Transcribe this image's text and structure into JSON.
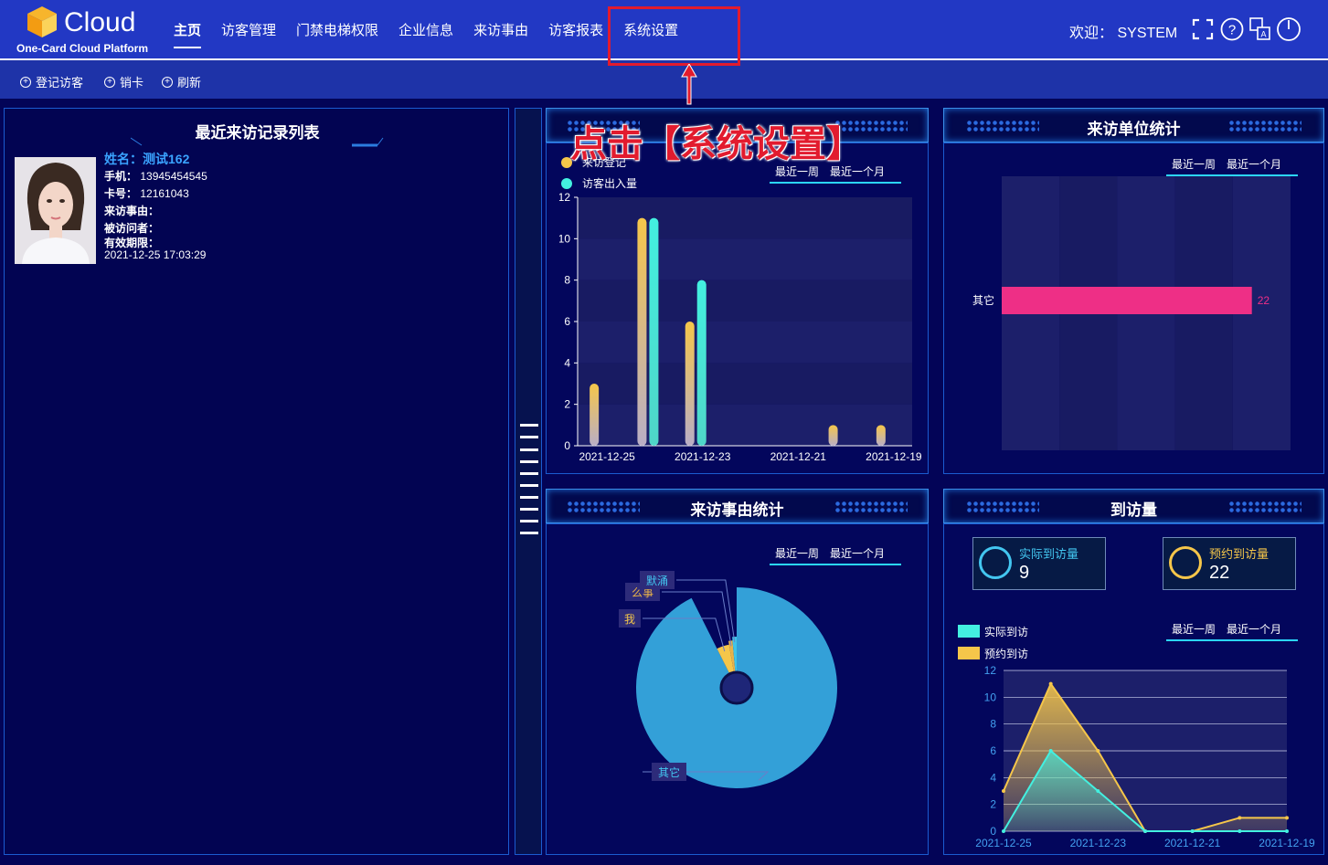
{
  "header": {
    "logo_text": "Cloud",
    "logo_sub": "One-Card Cloud Platform",
    "nav": [
      "主页",
      "访客管理",
      "门禁电梯权限",
      "企业信息",
      "来访事由",
      "访客报表",
      "系统设置"
    ],
    "welcome_label": "欢迎：",
    "user": "SYSTEM",
    "icons": [
      "fullscreen-icon",
      "help-icon",
      "translate-icon",
      "power-icon"
    ]
  },
  "toolbar": {
    "items": [
      "登记访客",
      "销卡",
      "刷新"
    ]
  },
  "annotation": {
    "text": "点击【系统设置】"
  },
  "recent_visits": {
    "title": "最近来访记录列表",
    "name": "姓名：测试162",
    "phone_label": "手机：",
    "phone": "13945454545",
    "card_label": "卡号：",
    "card": "12161043",
    "reason_label": "来访事由：",
    "visitee_label": "被访问者：",
    "expiry_label": "有效期限：",
    "expiry": "2021-12-25 17:03:29"
  },
  "panels": {
    "visitor_count": {
      "title": "",
      "tab_week": "最近一周",
      "tab_month": "最近一个月",
      "legend1": "来访登记",
      "legend2": "访客出入量"
    },
    "unit_stats": {
      "title": "来访单位统计",
      "tab_week": "最近一周",
      "tab_month": "最近一个月"
    },
    "reason_stats": {
      "title": "来访事由统计",
      "tab_week": "最近一周",
      "tab_month": "最近一个月"
    },
    "arrival": {
      "title": "到访量",
      "tab_week": "最近一周",
      "tab_month": "最近一个月",
      "actual_label": "实际到访量",
      "actual_value": "9",
      "reserved_label": "预约到访量",
      "reserved_value": "22",
      "legend1": "实际到访",
      "legend2": "预约到访"
    }
  },
  "colors": {
    "accent": "#2238c4",
    "yellow": "#f5c64a",
    "cyan": "#43f0e0",
    "pink": "#ee2f86",
    "pieblue": "#33a0d8",
    "red": "#e21b2e"
  },
  "chart_data": [
    {
      "type": "bar",
      "title": "",
      "categories": [
        "2021-12-25",
        "2021-12-24",
        "2021-12-23",
        "2021-12-22",
        "2021-12-21",
        "2021-12-20",
        "2021-12-19"
      ],
      "x_tick_labels": [
        "2021-12-25",
        "2021-12-23",
        "2021-12-21",
        "2021-12-19"
      ],
      "ylim": [
        0,
        12
      ],
      "y_ticks": [
        0,
        2,
        4,
        6,
        8,
        10,
        12
      ],
      "series": [
        {
          "name": "来访登记",
          "values": [
            3,
            11,
            6,
            0,
            0,
            1,
            1
          ]
        },
        {
          "name": "访客出入量",
          "values": [
            0,
            11,
            8,
            0,
            0,
            0,
            0
          ]
        }
      ]
    },
    {
      "type": "bar",
      "title": "来访单位统计",
      "orientation": "horizontal",
      "categories": [
        "其它"
      ],
      "values": [
        22
      ],
      "data_labels": [
        "22"
      ]
    },
    {
      "type": "pie",
      "title": "来访事由统计",
      "labels": [
        "其它",
        "我",
        "么事",
        "默涌"
      ],
      "values": [
        20,
        1,
        0.3,
        0.3
      ]
    },
    {
      "type": "area",
      "title": "到访量",
      "x": [
        "2021-12-25",
        "2021-12-24",
        "2021-12-23",
        "2021-12-22",
        "2021-12-21",
        "2021-12-20",
        "2021-12-19"
      ],
      "x_tick_labels": [
        "2021-12-25",
        "2021-12-23",
        "2021-12-21",
        "2021-12-19"
      ],
      "ylim": [
        0,
        12
      ],
      "y_ticks": [
        0,
        2,
        4,
        6,
        8,
        10,
        12
      ],
      "series": [
        {
          "name": "实际到访",
          "values": [
            0,
            6,
            3,
            0,
            0,
            0,
            0
          ]
        },
        {
          "name": "预约到访",
          "values": [
            3,
            11,
            6,
            0,
            0,
            1,
            1
          ]
        }
      ]
    }
  ]
}
